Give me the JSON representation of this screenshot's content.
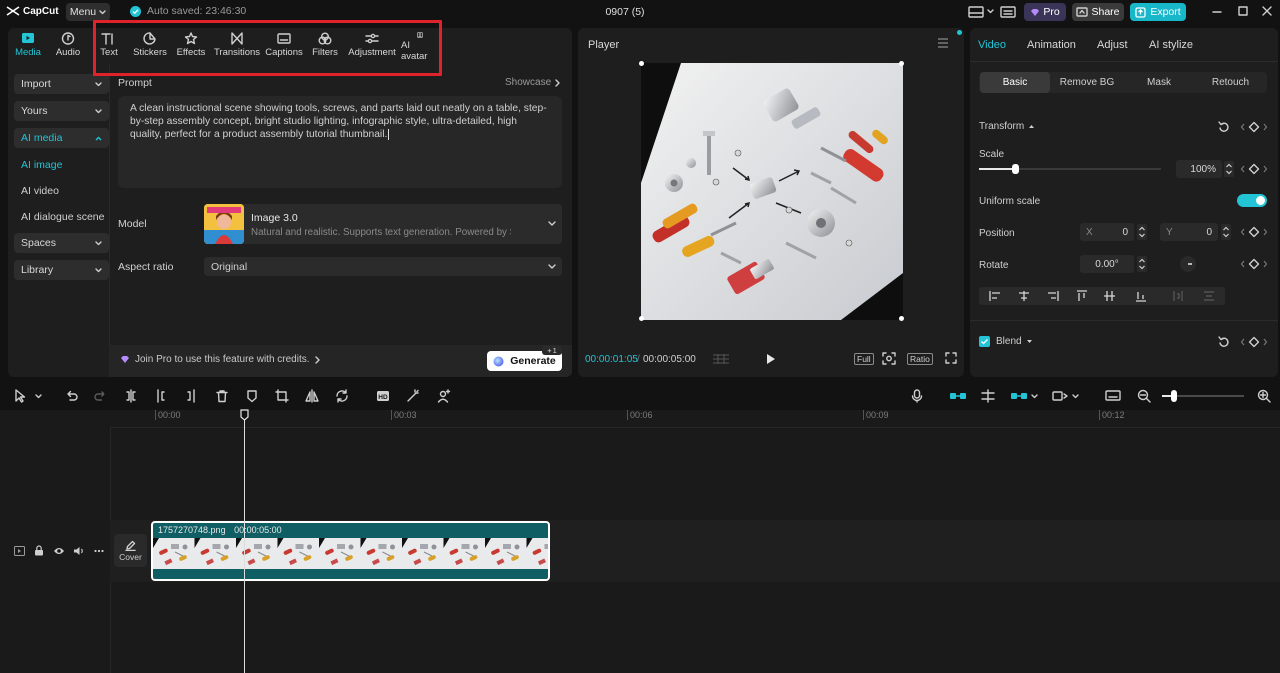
{
  "app": {
    "brand": "CapCut",
    "menu_label": "Menu",
    "autosave": "Auto saved: 23:46:30",
    "project_title": "0907 (5)",
    "pro_label": "Pro",
    "share_label": "Share",
    "export_label": "Export"
  },
  "tool_tabs": [
    {
      "label": "Media",
      "icon": "media-icon"
    },
    {
      "label": "Audio",
      "icon": "audio-icon"
    },
    {
      "label": "Text",
      "icon": "text-icon"
    },
    {
      "label": "Stickers",
      "icon": "stickers-icon"
    },
    {
      "label": "Effects",
      "icon": "effects-icon"
    },
    {
      "label": "Transitions",
      "icon": "transitions-icon"
    },
    {
      "label": "Captions",
      "icon": "captions-icon"
    },
    {
      "label": "Filters",
      "icon": "filters-icon"
    },
    {
      "label": "Adjustment",
      "icon": "adjustment-icon"
    },
    {
      "label": "AI avatar",
      "icon": "ai-avatar-icon"
    }
  ],
  "sidebar": {
    "items": [
      "Import",
      "Yours",
      "AI media"
    ],
    "sub_items": [
      "AI image",
      "AI video",
      "AI dialogue scene"
    ],
    "items_after": [
      "Spaces",
      "Library"
    ]
  },
  "ai_image": {
    "prompt_label": "Prompt",
    "showcase_label": "Showcase",
    "prompt_text": "A clean instructional scene showing tools, screws, and parts laid out neatly on a table, step-by-step assembly concept, bright studio lighting, infographic style, ultra-detailed, high quality, perfect for a product assembly tutorial thumbnail.",
    "model_label": "Model",
    "model_name": "Image 3.0",
    "model_desc": "Natural and realistic. Supports text generation. Powered by Seedre...",
    "aspect_label": "Aspect ratio",
    "aspect_value": "Original",
    "join_pro": "Join Pro to use this feature with credits.",
    "generate_label": "Generate",
    "generate_cost": "1"
  },
  "player": {
    "title": "Player",
    "current_time": "00:00:01:05",
    "total_time": "00:00:05:00",
    "full_label": "Full",
    "ratio_label": "Ratio"
  },
  "inspector": {
    "tabs": [
      "Video",
      "Animation",
      "Adjust",
      "AI stylize"
    ],
    "segments": [
      "Basic",
      "Remove BG",
      "Mask",
      "Retouch"
    ],
    "transform_label": "Transform",
    "scale_label": "Scale",
    "scale_value": "100%",
    "scale_fraction": 0.2,
    "uniform_scale_label": "Uniform scale",
    "uniform_scale_on": true,
    "position_label": "Position",
    "pos_x_label": "X",
    "pos_x": "0",
    "pos_y_label": "Y",
    "pos_y": "0",
    "rotate_label": "Rotate",
    "rotate_value": "0.00°",
    "blend_label": "Blend"
  },
  "timeline": {
    "ruler": [
      "00:00",
      "00:03",
      "00:06",
      "00:09",
      "00:12"
    ],
    "clip_name": "1757270748.png",
    "clip_duration": "00:00:05:00",
    "cover_label": "Cover"
  },
  "colors": {
    "accent": "#22c4d6",
    "highlight": "#e0222d",
    "clip": "#0f5e63"
  }
}
